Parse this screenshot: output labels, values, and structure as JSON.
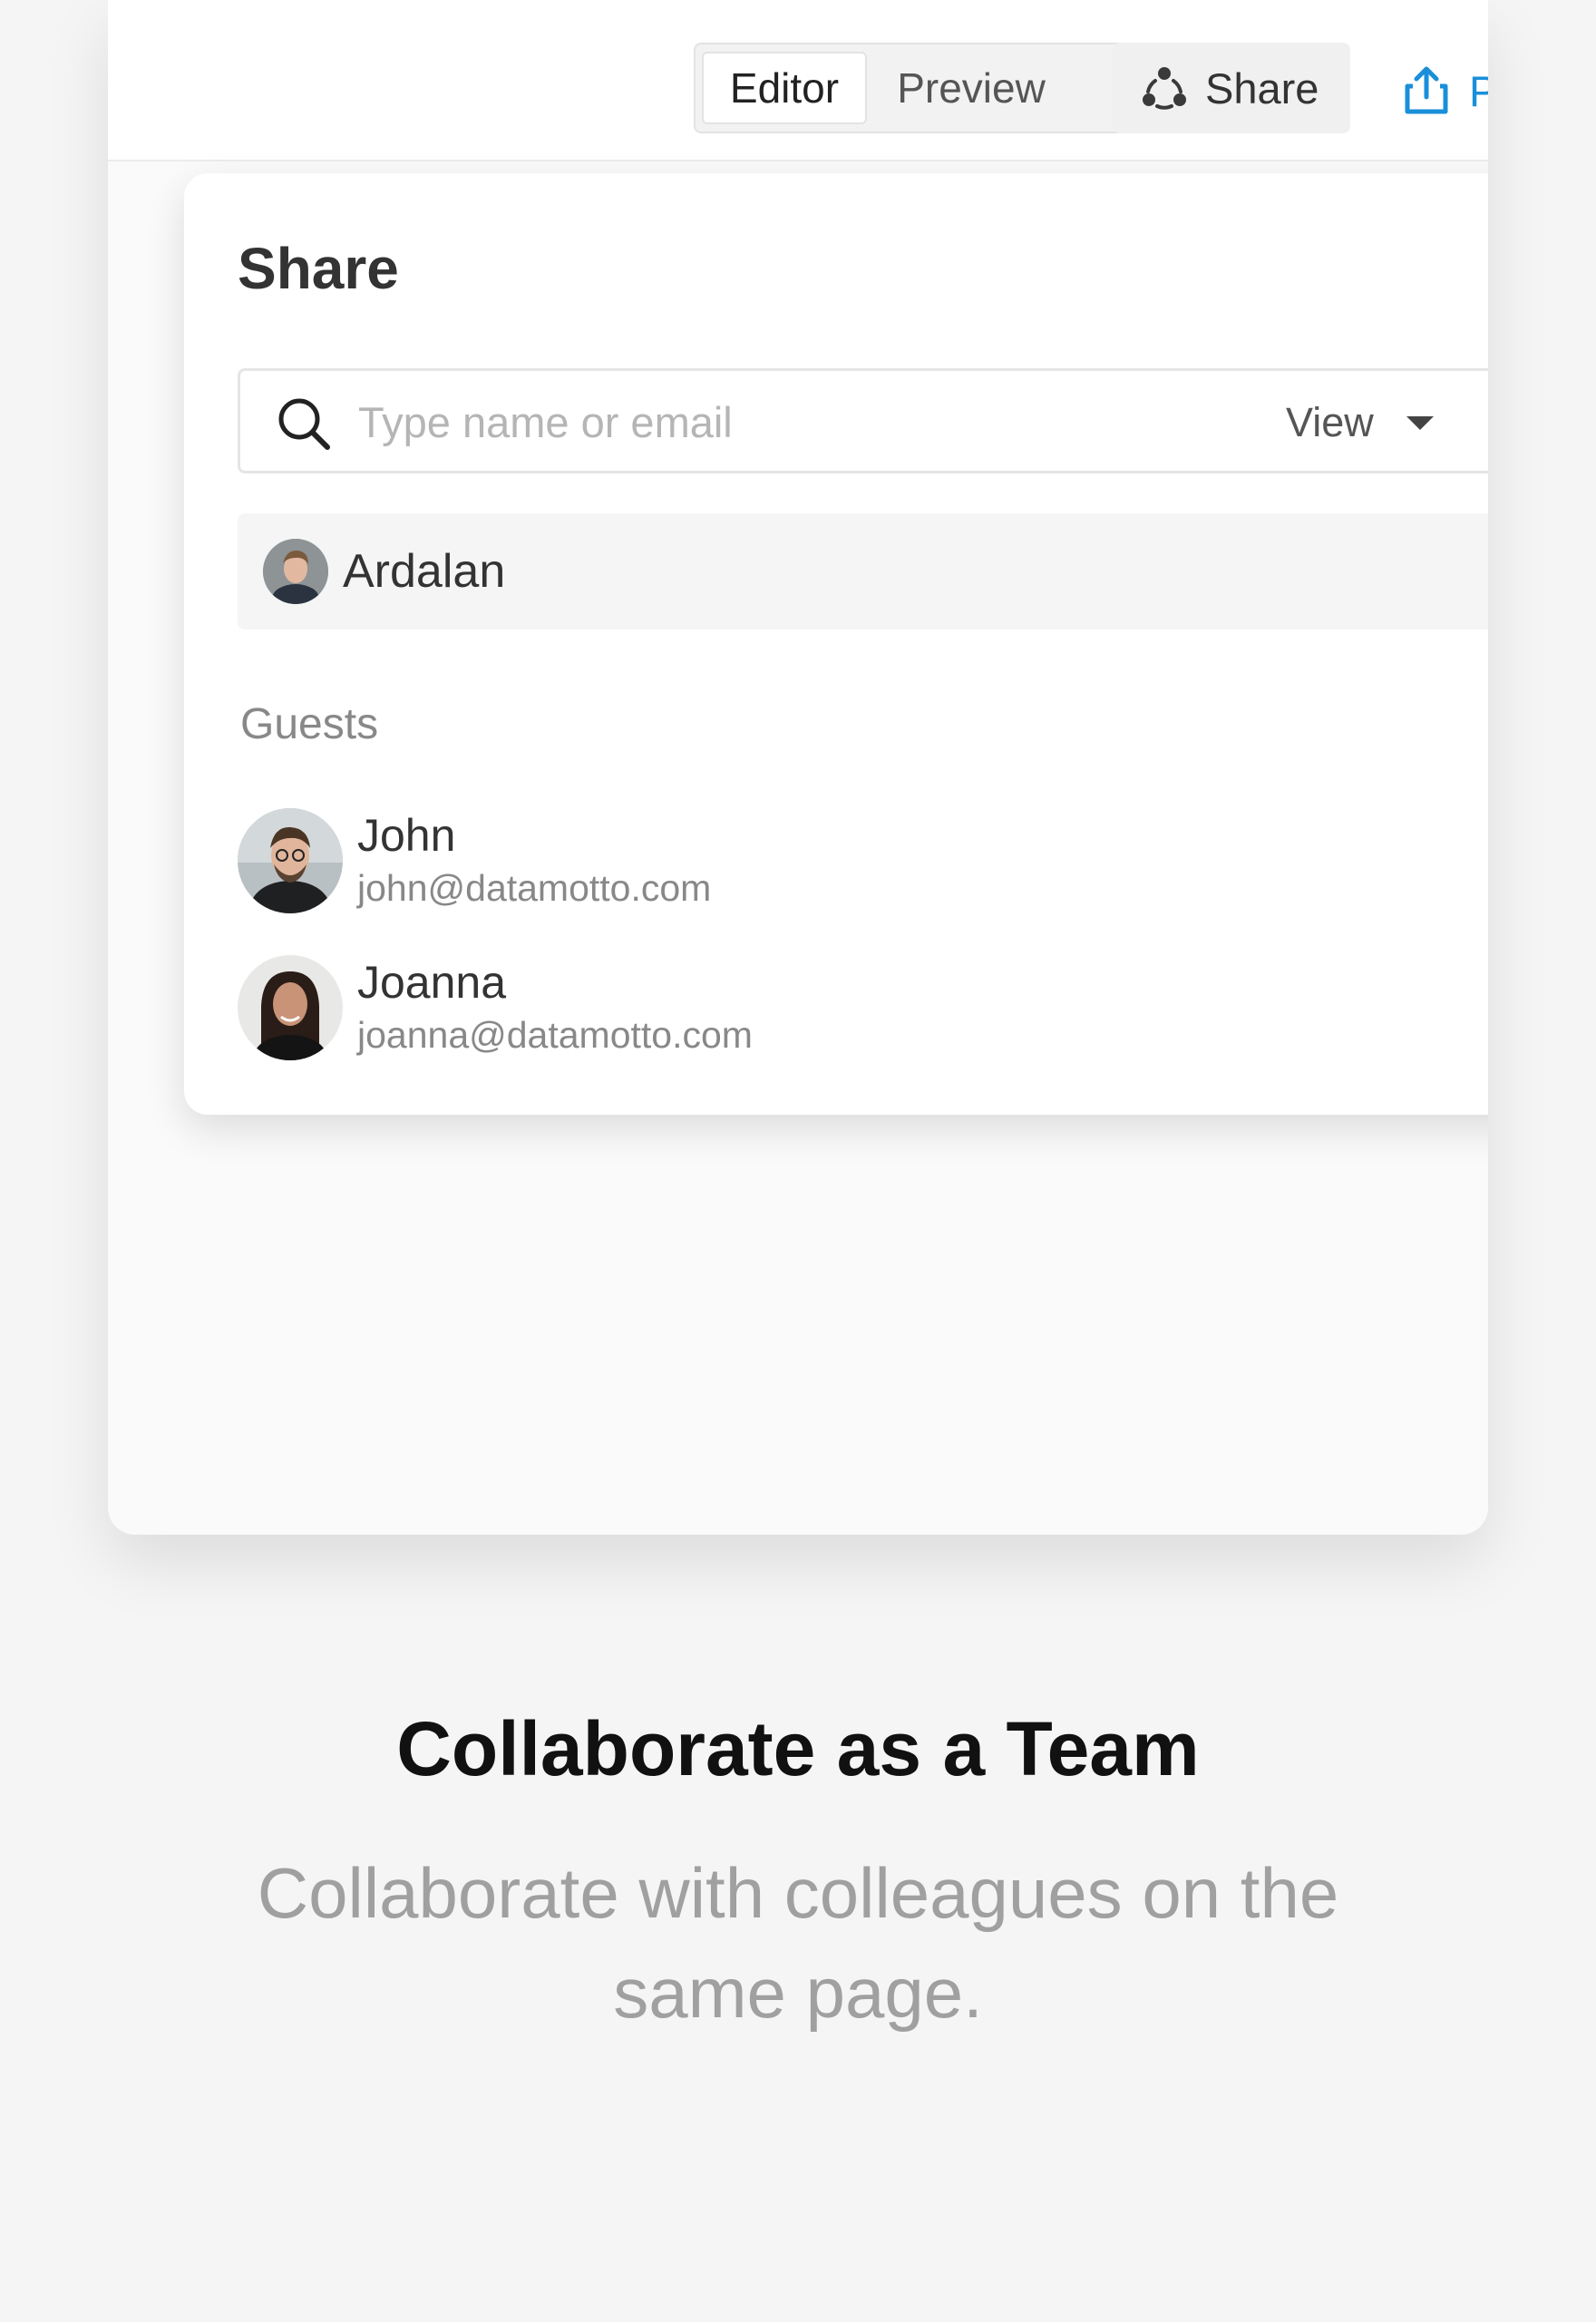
{
  "toolbar": {
    "mode_tabs": [
      {
        "label": "Editor",
        "active": true
      },
      {
        "label": "Preview",
        "active": false
      }
    ],
    "share_label": "Share",
    "share_icon": "people-share-icon",
    "publish_label": "P",
    "publish_icon": "upload-icon",
    "accent_color": "#1a8fd9"
  },
  "share_dialog": {
    "title": "Share",
    "search": {
      "placeholder": "Type name or email",
      "value": "",
      "icon": "search-icon"
    },
    "permission": {
      "selected": "View",
      "icon": "caret-down-icon"
    },
    "selected_user": {
      "name": "Ardalan"
    },
    "guests_label": "Guests",
    "guests": [
      {
        "name": "John",
        "email": "john@datamotto.com"
      },
      {
        "name": "Joanna",
        "email": "joanna@datamotto.com"
      }
    ]
  },
  "marketing": {
    "headline": "Collaborate as a Team",
    "subtitle": "Collaborate with colleagues on the same page."
  }
}
